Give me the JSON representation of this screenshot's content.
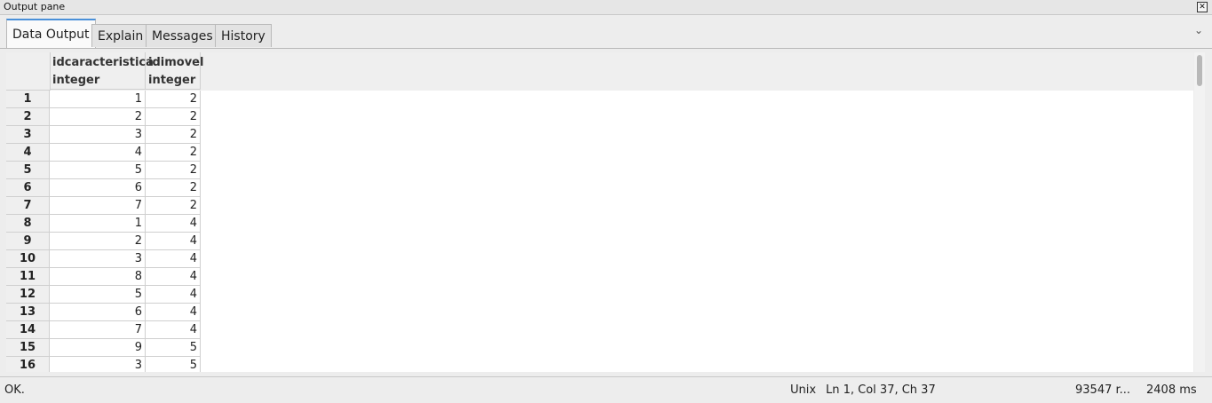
{
  "pane": {
    "title": "Output pane",
    "close_icon": "close-icon"
  },
  "tabs": [
    {
      "label": "Data Output",
      "active": true
    },
    {
      "label": "Explain",
      "active": false
    },
    {
      "label": "Messages",
      "active": false
    },
    {
      "label": "History",
      "active": false
    }
  ],
  "tab_menu_icon": "chevron-down-icon",
  "grid": {
    "columns": [
      {
        "name": "idcaracteristica",
        "type": "integer"
      },
      {
        "name": "idimovel",
        "type": "integer"
      }
    ],
    "rows": [
      {
        "num": "1",
        "idcaracteristica": "1",
        "idimovel": "2"
      },
      {
        "num": "2",
        "idcaracteristica": "2",
        "idimovel": "2"
      },
      {
        "num": "3",
        "idcaracteristica": "3",
        "idimovel": "2"
      },
      {
        "num": "4",
        "idcaracteristica": "4",
        "idimovel": "2"
      },
      {
        "num": "5",
        "idcaracteristica": "5",
        "idimovel": "2"
      },
      {
        "num": "6",
        "idcaracteristica": "6",
        "idimovel": "2"
      },
      {
        "num": "7",
        "idcaracteristica": "7",
        "idimovel": "2"
      },
      {
        "num": "8",
        "idcaracteristica": "1",
        "idimovel": "4"
      },
      {
        "num": "9",
        "idcaracteristica": "2",
        "idimovel": "4"
      },
      {
        "num": "10",
        "idcaracteristica": "3",
        "idimovel": "4"
      },
      {
        "num": "11",
        "idcaracteristica": "8",
        "idimovel": "4"
      },
      {
        "num": "12",
        "idcaracteristica": "5",
        "idimovel": "4"
      },
      {
        "num": "13",
        "idcaracteristica": "6",
        "idimovel": "4"
      },
      {
        "num": "14",
        "idcaracteristica": "7",
        "idimovel": "4"
      },
      {
        "num": "15",
        "idcaracteristica": "9",
        "idimovel": "5"
      },
      {
        "num": "16",
        "idcaracteristica": "3",
        "idimovel": "5"
      }
    ]
  },
  "status": {
    "message": "OK.",
    "line_ending": "Unix",
    "position": "Ln 1, Col 37, Ch 37",
    "rows": "93547 r...",
    "time": "2408 ms"
  }
}
